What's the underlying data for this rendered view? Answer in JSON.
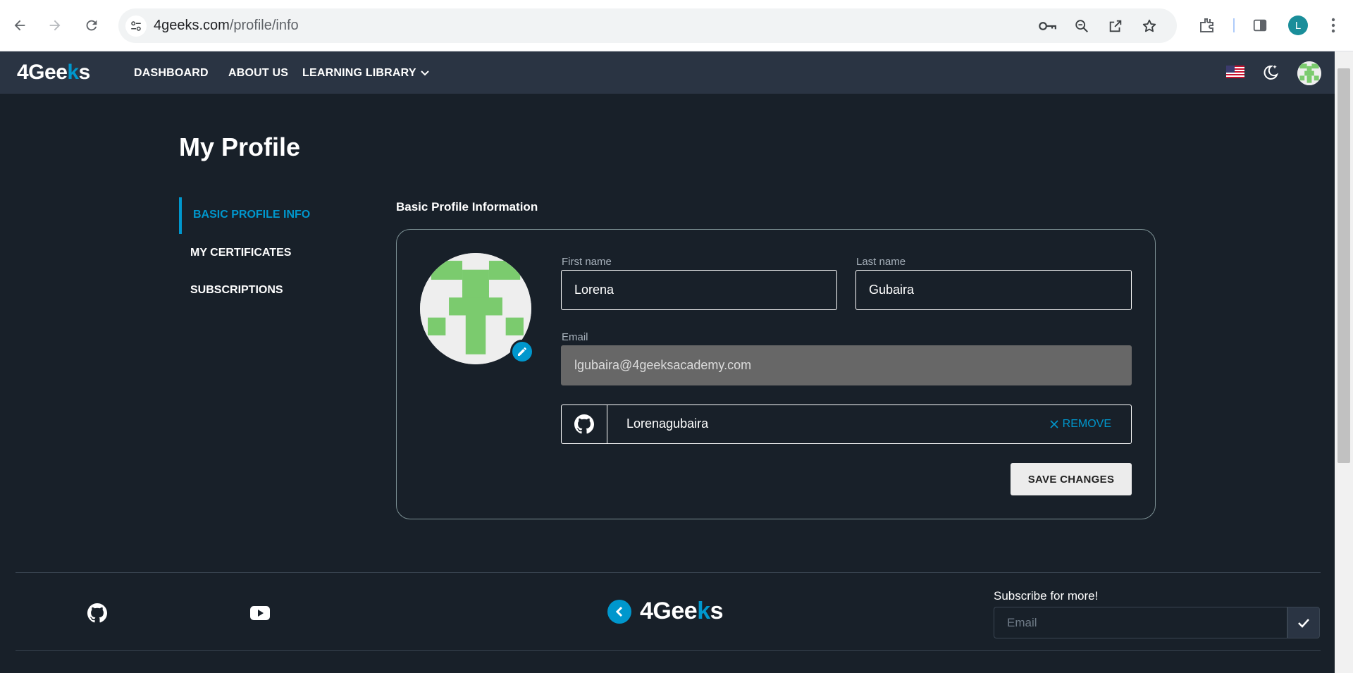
{
  "browser": {
    "url_domain": "4geeks.com",
    "url_path": "/profile/info",
    "profile_initial": "L",
    "icons": [
      "back-icon",
      "forward-icon",
      "reload-icon",
      "site-settings-icon",
      "key-icon",
      "zoom-icon",
      "share-icon",
      "star-icon",
      "extensions-icon",
      "sidepanel-icon",
      "menu-dots-icon"
    ]
  },
  "header": {
    "logo_main": "4Gee",
    "logo_k": "k",
    "logo_end": "s",
    "menu": {
      "dashboard": "DASHBOARD",
      "about": "ABOUT US",
      "library": "LEARNING LIBRARY"
    }
  },
  "page": {
    "title": "My Profile"
  },
  "sidebar": {
    "items": [
      {
        "label": "BASIC PROFILE INFO",
        "active": true
      },
      {
        "label": "MY CERTIFICATES",
        "active": false
      },
      {
        "label": "SUBSCRIPTIONS",
        "active": false
      }
    ]
  },
  "profile": {
    "section_title": "Basic Profile Information",
    "first_name_label": "First name",
    "first_name": "Lorena",
    "last_name_label": "Last name",
    "last_name": "Gubaira",
    "email_label": "Email",
    "email": "lgubaira@4geeksacademy.com",
    "github_user": "Lorenagubaira",
    "remove_label": "REMOVE",
    "save_label": "SAVE CHANGES"
  },
  "footer": {
    "logo_main": "4Gee",
    "logo_k": "k",
    "logo_end": "s",
    "subscribe_label": "Subscribe for more!",
    "subscribe_placeholder": "Email"
  },
  "colors": {
    "accent": "#0097cd",
    "background": "#182029",
    "header": "#2a3443",
    "avatar_green": "#7bcb6e"
  }
}
